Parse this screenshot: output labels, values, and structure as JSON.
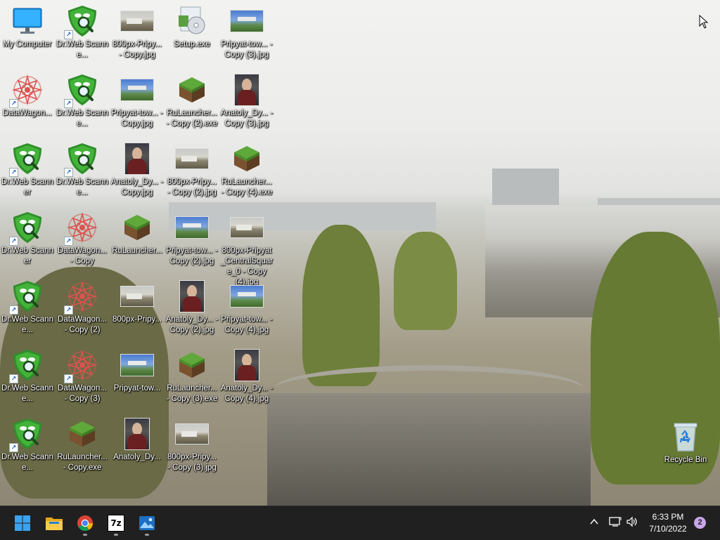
{
  "desktop": {
    "icons": [
      {
        "label": "My Computer",
        "icon": "computer-icon"
      },
      {
        "label": "Dr.Web Scanne...",
        "icon": "drweb-icon"
      },
      {
        "label": "800px-Pripy... - Copy.jpg",
        "icon": "photo-icon"
      },
      {
        "label": "Setup.exe",
        "icon": "setup-icon"
      },
      {
        "label": "Pripyat-tow... - Copy (3).jpg",
        "icon": "photo-icon"
      },
      {
        "label": "DataWagon...",
        "icon": "datawagon-icon"
      },
      {
        "label": "Dr.Web Scanne...",
        "icon": "drweb-icon"
      },
      {
        "label": "Pripyat-tow... - Copy.jpg",
        "icon": "photo-icon"
      },
      {
        "label": "RuLauncher... - Copy (2).exe",
        "icon": "grass-block-icon"
      },
      {
        "label": "Anatoly_Dy... - Copy (3).jpg",
        "icon": "portrait-photo-icon"
      },
      {
        "label": "Dr.Web Scanner",
        "icon": "drweb-icon"
      },
      {
        "label": "Dr.Web Scanne...",
        "icon": "drweb-icon"
      },
      {
        "label": "Anatoly_Dy... - Copy.jpg",
        "icon": "portrait-photo-icon"
      },
      {
        "label": "800px-Pripy... - Copy (2).jpg",
        "icon": "photo-icon"
      },
      {
        "label": "RuLauncher... - Copy (4).exe",
        "icon": "grass-block-icon"
      },
      {
        "label": "Dr.Web Scanner",
        "icon": "drweb-icon"
      },
      {
        "label": "DataWagon... - Copy",
        "icon": "datawagon-icon"
      },
      {
        "label": "RuLauncher...",
        "icon": "grass-block-icon"
      },
      {
        "label": "Pripyat-tow... - Copy (2).jpg",
        "icon": "photo-icon"
      },
      {
        "label": "800px-Pripyat _CentralSquar e_0 - Copy (4).jpg",
        "icon": "photo-icon"
      },
      {
        "label": "Dr.Web Scanne...",
        "icon": "drweb-icon"
      },
      {
        "label": "DataWagon... - Copy (2)",
        "icon": "datawagon-icon"
      },
      {
        "label": "800px-Pripy...",
        "icon": "photo-icon"
      },
      {
        "label": "Anatoly_Dy... - Copy (2).jpg",
        "icon": "portrait-photo-icon"
      },
      {
        "label": "Pripyat-tow... - Copy (4).jpg",
        "icon": "photo-icon"
      },
      {
        "label": "Dr.Web Scanne...",
        "icon": "drweb-icon"
      },
      {
        "label": "DataWagon... - Copy (3)",
        "icon": "datawagon-icon"
      },
      {
        "label": "Pripyat-tow...",
        "icon": "photo-icon"
      },
      {
        "label": "RuLauncher... - Copy (3).exe",
        "icon": "grass-block-icon"
      },
      {
        "label": "Anatoly_Dy... - Copy (4).jpg",
        "icon": "portrait-photo-icon"
      },
      {
        "label": "Dr.Web Scanne...",
        "icon": "drweb-icon"
      },
      {
        "label": "RuLauncher... - Copy.exe",
        "icon": "grass-block-icon"
      },
      {
        "label": "Anatoly_Dy...",
        "icon": "portrait-photo-icon"
      },
      {
        "label": "800px-Pripy... - Copy (3).jpg",
        "icon": "photo-icon"
      }
    ],
    "recycle_bin": {
      "label": "Recycle Bin",
      "icon": "recycle-bin-icon"
    }
  },
  "taskbar": {
    "apps": [
      {
        "name": "Start",
        "icon": "windows-start-icon"
      },
      {
        "name": "File Explorer",
        "icon": "folder-icon"
      },
      {
        "name": "Google Chrome",
        "icon": "chrome-icon"
      },
      {
        "name": "7-Zip",
        "icon": "7zip-icon",
        "text": "7z"
      },
      {
        "name": "Photos",
        "icon": "photos-icon"
      }
    ],
    "tray": {
      "time": "6:33 PM",
      "date": "7/10/2022",
      "notification_count": "2"
    }
  },
  "colors": {
    "taskbar_bg": "#202020",
    "drweb_green": "#3fa535",
    "accent": "#0078d4"
  }
}
